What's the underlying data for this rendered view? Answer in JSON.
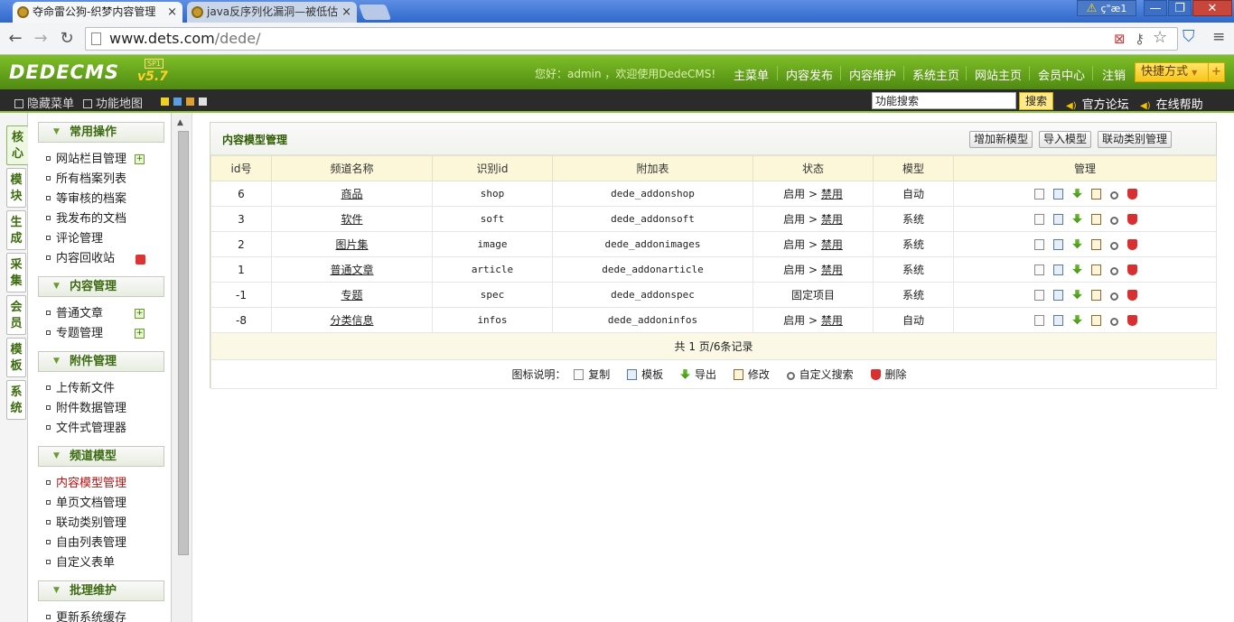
{
  "browser": {
    "tabs": [
      {
        "title": "夺命雷公狗-织梦内容管理"
      },
      {
        "title": "java反序列化漏洞—被低估"
      }
    ],
    "tab_close": "×",
    "window_user": "ç\"æ1",
    "win_min": "—",
    "win_max": "❐",
    "win_close": "✕",
    "back": "←",
    "forward": "→",
    "reload": "↻",
    "url_domain": "www.dets.com",
    "url_path": "/dede/"
  },
  "header": {
    "logo": "DEDECMS",
    "version": "v5.7",
    "sp": "SP1",
    "welcome": "您好：admin ，欢迎使用DedeCMS!",
    "nav": [
      "主菜单",
      "内容发布",
      "内容维护",
      "系统主页",
      "网站主页",
      "会员中心",
      "注销"
    ],
    "quick": "快捷方式",
    "quick_plus": "+"
  },
  "subbar": {
    "hide_menu": "隐藏菜单",
    "site_map": "功能地图",
    "search_value": "功能搜索",
    "search_btn": "搜索",
    "forum": "官方论坛",
    "help": "在线帮助",
    "skins": [
      "#f0d020",
      "#5aa0e0",
      "#e0a030",
      "#e0e0e0"
    ]
  },
  "vtabs": [
    "核心",
    "模块",
    "生成",
    "采集",
    "会员",
    "模板",
    "系统"
  ],
  "menu": {
    "groups": [
      {
        "title": "常用操作",
        "items": [
          "网站栏目管理",
          "所有档案列表",
          "等审核的档案",
          "我发布的文档",
          "评论管理",
          "内容回收站"
        ]
      },
      {
        "title": "内容管理",
        "items": [
          "普通文章",
          "专题管理"
        ]
      },
      {
        "title": "附件管理",
        "items": [
          "上传新文件",
          "附件数据管理",
          "文件式管理器"
        ]
      },
      {
        "title": "频道模型",
        "items": [
          "内容模型管理",
          "单页文档管理",
          "联动类别管理",
          "自由列表管理",
          "自定义表单"
        ]
      },
      {
        "title": "批理维护",
        "items": [
          "更新系统缓存"
        ]
      }
    ]
  },
  "panel": {
    "title": "内容模型管理",
    "buttons": [
      "增加新模型",
      "导入模型",
      "联动类别管理"
    ],
    "columns": [
      "id号",
      "频道名称",
      "识别id",
      "附加表",
      "状态",
      "模型",
      "管理"
    ],
    "rows": [
      {
        "id": "6",
        "name": "商品",
        "nid": "shop",
        "table": "dede_addonshop",
        "status": "启用",
        "ban": "禁用",
        "model": "自动"
      },
      {
        "id": "3",
        "name": "软件",
        "nid": "soft",
        "table": "dede_addonsoft",
        "status": "启用",
        "ban": "禁用",
        "model": "系统"
      },
      {
        "id": "2",
        "name": "图片集",
        "nid": "image",
        "table": "dede_addonimages",
        "status": "启用",
        "ban": "禁用",
        "model": "系统"
      },
      {
        "id": "1",
        "name": "普通文章",
        "nid": "article",
        "table": "dede_addonarticle",
        "status": "启用",
        "ban": "禁用",
        "model": "系统"
      },
      {
        "id": "-1",
        "name": "专题",
        "nid": "spec",
        "table": "dede_addonspec",
        "status": "固定项目",
        "ban": "",
        "model": "系统"
      },
      {
        "id": "-8",
        "name": "分类信息",
        "nid": "infos",
        "table": "dede_addoninfos",
        "status": "启用",
        "ban": "禁用",
        "model": "自动"
      }
    ],
    "arrow": ">",
    "pager": "共 1 页/6条记录",
    "legend_label": "图标说明：",
    "legend": [
      "复制",
      "模板",
      "导出",
      "修改",
      "自定义搜索",
      "删除"
    ]
  }
}
